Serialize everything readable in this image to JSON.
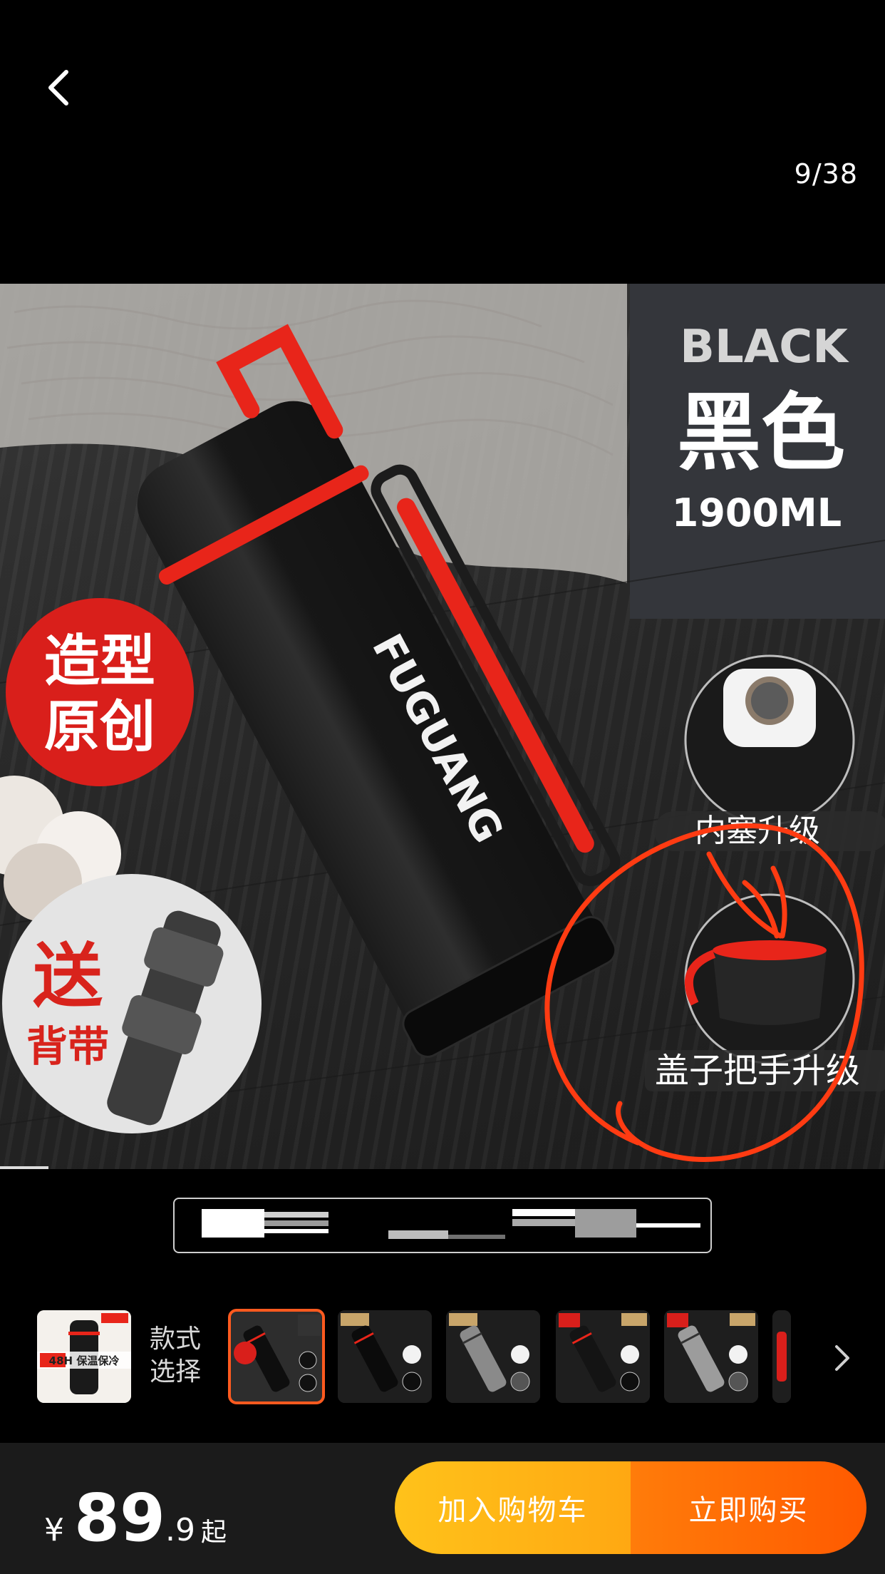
{
  "header": {
    "back_icon": "chevron-left-icon",
    "image_counter": "9/38"
  },
  "hero_image": {
    "brand_text": "FUGUANG",
    "color_en": "BLACK",
    "color_cn": "黑色",
    "capacity": "1900ML",
    "badge_original": "造型\n原创",
    "badge_original_line1": "造型",
    "badge_original_line2": "原创",
    "gift_big": "送",
    "gift_small": "背带",
    "feature_1": "内塞升级",
    "feature_2": "盖子把手升级",
    "annotation_color": "#ff3b12"
  },
  "style_selector": {
    "label": "款式\n选择",
    "label_line1": "款式",
    "label_line2": "选择",
    "first_thumb_text": "48H 保温保冷",
    "next_icon": "chevron-right-icon",
    "selected_index": 1
  },
  "bottom_bar": {
    "currency": "¥",
    "price_int": "89",
    "price_dec": ".9",
    "price_suffix": "起",
    "add_to_cart": "加入购物车",
    "buy_now": "立即购买"
  },
  "colors": {
    "accent_orange": "#ff5a00",
    "cart_yellow": "#ffb315",
    "selected_outline": "#ff5a1f"
  }
}
